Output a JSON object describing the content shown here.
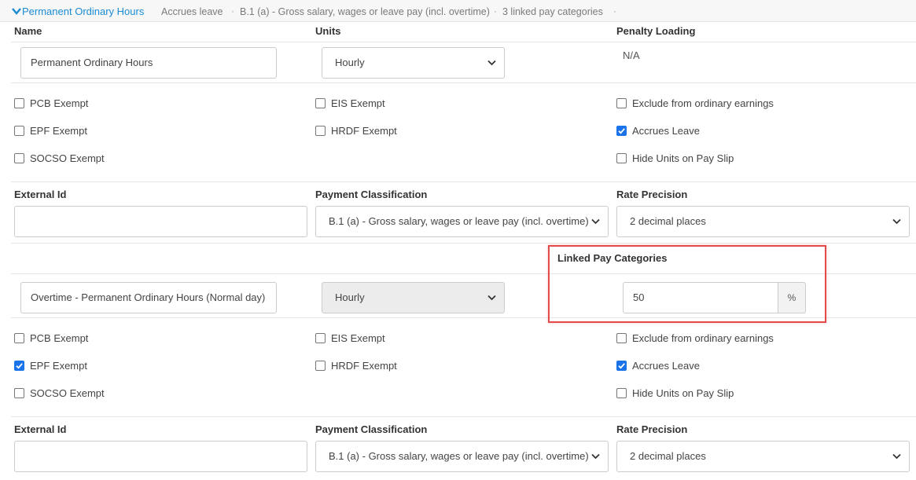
{
  "header": {
    "title": "Permanent Ordinary Hours",
    "accrues": "Accrues leave",
    "classification": "B.1 (a) - Gross salary, wages or leave pay (incl. overtime)",
    "linked": "3 linked pay categories",
    "link_color": "#1a8bd3"
  },
  "columns": {
    "name": "Name",
    "units": "Units",
    "penalty": "Penalty Loading"
  },
  "primary": {
    "name_value": "Permanent Ordinary Hours",
    "units_value": "Hourly",
    "penalty_value": "N/A",
    "checkboxes": {
      "pcb": {
        "label": "PCB Exempt",
        "checked": false
      },
      "epf": {
        "label": "EPF Exempt",
        "checked": false
      },
      "socso": {
        "label": "SOCSO Exempt",
        "checked": false
      },
      "eis": {
        "label": "EIS Exempt",
        "checked": false
      },
      "hrdf": {
        "label": "HRDF Exempt",
        "checked": false
      },
      "exclude": {
        "label": "Exclude from ordinary earnings",
        "checked": false
      },
      "accrues": {
        "label": "Accrues Leave",
        "checked": true
      },
      "hide_units": {
        "label": "Hide Units on Pay Slip",
        "checked": false
      }
    },
    "external_id_label": "External Id",
    "external_id_value": "",
    "payment_label": "Payment Classification",
    "payment_value": "B.1 (a) - Gross salary, wages or leave pay (incl. overtime)",
    "precision_label": "Rate Precision",
    "precision_value": "2 decimal places"
  },
  "linked_section": {
    "heading": "Linked Pay Categories",
    "highlight_color": "#e34a4a"
  },
  "linked": {
    "name_value": "Overtime - Permanent Ordinary Hours (Normal day)",
    "units_value": "Hourly",
    "rate_value": "50",
    "rate_unit": "%",
    "checkboxes": {
      "pcb": {
        "label": "PCB Exempt",
        "checked": false
      },
      "epf": {
        "label": "EPF Exempt",
        "checked": true
      },
      "socso": {
        "label": "SOCSO Exempt",
        "checked": false
      },
      "eis": {
        "label": "EIS Exempt",
        "checked": false
      },
      "hrdf": {
        "label": "HRDF Exempt",
        "checked": false
      },
      "exclude": {
        "label": "Exclude from ordinary earnings",
        "checked": false
      },
      "accrues": {
        "label": "Accrues Leave",
        "checked": true
      },
      "hide_units": {
        "label": "Hide Units on Pay Slip",
        "checked": false
      }
    },
    "external_id_label": "External Id",
    "external_id_value": "",
    "payment_label": "Payment Classification",
    "payment_value": "B.1 (a) - Gross salary, wages or leave pay (incl. overtime)",
    "precision_label": "Rate Precision",
    "precision_value": "2 decimal places"
  },
  "accent_checkbox": "#1a73e8"
}
